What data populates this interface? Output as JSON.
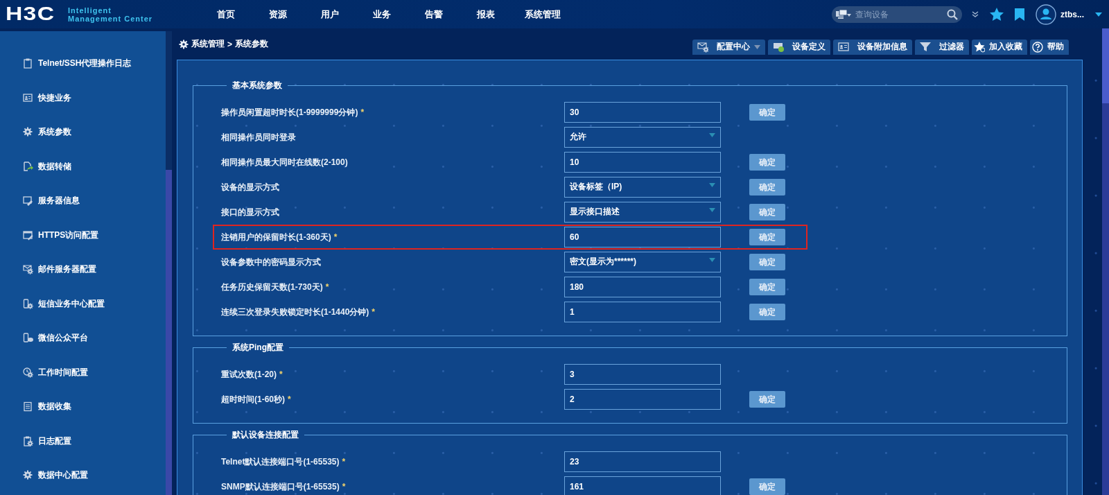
{
  "header": {
    "logo_mark": "H3C",
    "logo_line1": "Intelligent",
    "logo_line2": "Management Center",
    "nav": [
      {
        "label": "首页"
      },
      {
        "label": "资源"
      },
      {
        "label": "用户"
      },
      {
        "label": "业务"
      },
      {
        "label": "告警"
      },
      {
        "label": "报表"
      },
      {
        "label": "系统管理"
      }
    ],
    "search": {
      "placeholder": "查询设备"
    },
    "user": "ztbs..."
  },
  "sidebar": {
    "items": [
      {
        "label": "Telnet/SSH代理操作日志"
      },
      {
        "label": "快捷业务"
      },
      {
        "label": "系统参数"
      },
      {
        "label": "数据转储"
      },
      {
        "label": "服务器信息"
      },
      {
        "label": "HTTPS访问配置"
      },
      {
        "label": "邮件服务器配置"
      },
      {
        "label": "短信业务中心配置"
      },
      {
        "label": "微信公众平台"
      },
      {
        "label": "工作时间配置"
      },
      {
        "label": "数据收集"
      },
      {
        "label": "日志配置"
      },
      {
        "label": "数据中心配置"
      }
    ]
  },
  "breadcrumb": {
    "path": "系统管理",
    "separator": ">",
    "current": "系统参数"
  },
  "toolbar": [
    {
      "label": "配置中心",
      "dropdown": true
    },
    {
      "label": "设备定义",
      "dropdown": false
    },
    {
      "label": "设备附加信息",
      "dropdown": false
    },
    {
      "label": "过滤器",
      "dropdown": false
    },
    {
      "label": "加入收藏",
      "dropdown": false
    },
    {
      "label": "帮助",
      "dropdown": false
    }
  ],
  "sections": [
    {
      "title": "基本系统参数",
      "rows": [
        {
          "label": "操作员闲置超时时长(1-9999999分钟)",
          "mark": "*",
          "kind": "input",
          "value": "30",
          "button": "确定",
          "highlighted": false
        },
        {
          "label": "相同操作员同时登录",
          "kind": "select",
          "value": "允许",
          "highlighted": false
        },
        {
          "label": "相同操作员最大同时在线数(2-100)",
          "kind": "input",
          "value": "10",
          "button": "确定",
          "highlighted": false
        },
        {
          "label": "设备的显示方式",
          "kind": "select",
          "value": "设备标签（IP)",
          "button": "确定",
          "highlighted": false
        },
        {
          "label": "接口的显示方式",
          "kind": "select",
          "value": "显示接口描述",
          "button": "确定",
          "highlighted": false
        },
        {
          "label": "注销用户的保留时长(1-360天)",
          "mark": "*",
          "kind": "input",
          "value": "60",
          "button": "确定",
          "highlighted": true
        },
        {
          "label": "设备参数中的密码显示方式",
          "kind": "select",
          "value": "密文(显示为******)",
          "button": "确定",
          "highlighted": false
        },
        {
          "label": "任务历史保留天数(1-730天)",
          "mark": "*",
          "kind": "input",
          "value": "180",
          "button": "确定",
          "highlighted": false
        },
        {
          "label": "连续三次登录失败锁定时长(1-1440分钟)",
          "mark": "*",
          "kind": "input",
          "value": "1",
          "button": "确定",
          "highlighted": false
        }
      ]
    },
    {
      "title": "系统Ping配置",
      "rows": [
        {
          "label": "重试次数(1-20)",
          "mark": "*",
          "kind": "input",
          "value": "3",
          "highlighted": false
        },
        {
          "label": "超时时间(1-60秒)",
          "mark": "*",
          "kind": "input",
          "value": "2",
          "button": "确定",
          "highlighted": false
        }
      ]
    },
    {
      "title": "默认设备连接配置",
      "rows": [
        {
          "label": "Telnet默认连接端口号(1-65535)",
          "mark": "*",
          "kind": "input",
          "value": "23",
          "highlighted": false
        },
        {
          "label": "SNMP默认连接端口号(1-65535)",
          "mark": "*",
          "kind": "input",
          "value": "161",
          "button": "确定",
          "highlighted": false
        }
      ]
    }
  ]
}
